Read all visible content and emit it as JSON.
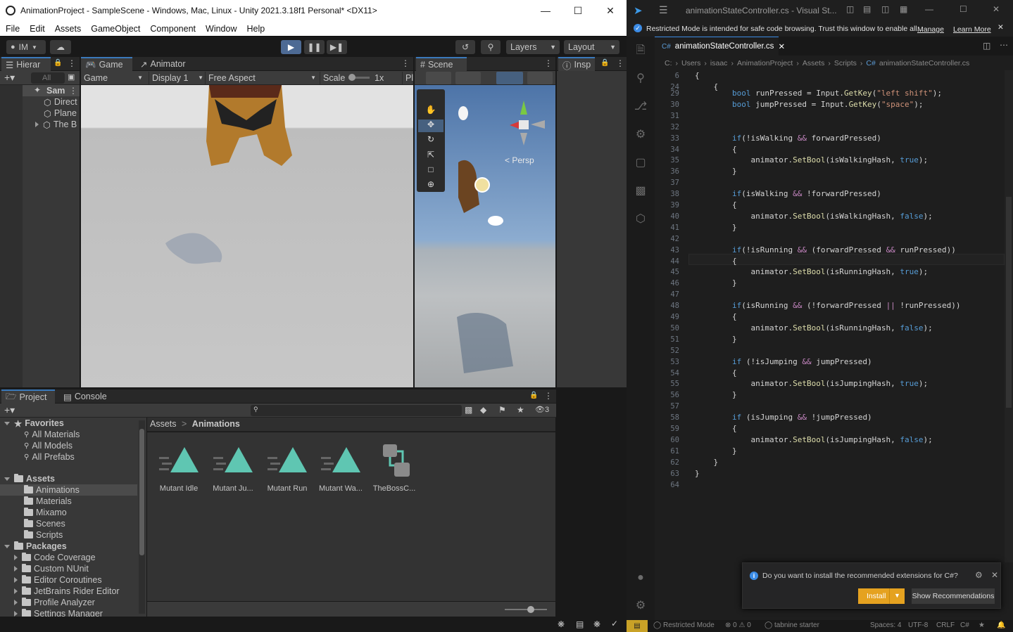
{
  "unity": {
    "title": "AnimationProject - SampleScene - Windows, Mac, Linux - Unity 2021.3.18f1 Personal* <DX11>",
    "menu": [
      "File",
      "Edit",
      "Assets",
      "GameObject",
      "Component",
      "Window",
      "Help"
    ],
    "account": "IM",
    "layers_label": "Layers",
    "layout_label": "Layout",
    "hierarchy": {
      "tab": "Hierar",
      "search_placeholder": "All",
      "scene": "Sam",
      "items": [
        "Direct",
        "Plane",
        "The B"
      ]
    },
    "game": {
      "tab_game": "Game",
      "tab_animator": "Animator",
      "dropdown_game": "Game",
      "display": "Display 1",
      "aspect": "Free Aspect",
      "scale_label": "Scale",
      "scale_value": "1x",
      "extra": "Pl"
    },
    "scene": {
      "tab": "Scene",
      "persp": "Persp"
    },
    "inspector": {
      "tab": "Insp"
    },
    "project": {
      "tab_project": "Project",
      "tab_console": "Console",
      "hidden_count": "3",
      "favorites_label": "Favorites",
      "favorites": [
        "All Materials",
        "All Models",
        "All Prefabs"
      ],
      "assets_label": "Assets",
      "asset_folders": [
        "Animations",
        "Materials",
        "Mixamo",
        "Scenes",
        "Scripts"
      ],
      "packages_label": "Packages",
      "packages": [
        "Code Coverage",
        "Custom NUnit",
        "Editor Coroutines",
        "JetBrains Rider Editor",
        "Profile Analyzer",
        "Settings Manager"
      ],
      "breadcrumb": [
        "Assets",
        "Animations"
      ],
      "assets": [
        "Mutant Idle",
        "Mutant Ju...",
        "Mutant Run",
        "Mutant Wa...",
        "TheBossC..."
      ]
    }
  },
  "vscode": {
    "title": "animationStateController.cs - Visual St...",
    "banner": "Restricted Mode is intended for safe code browsing. Trust this window to enable all...",
    "banner_manage": "Manage",
    "banner_learn": "Learn More",
    "tab_name": "animationStateController.cs",
    "breadcrumb": [
      "C:",
      "Users",
      "isaac",
      "AnimationProject",
      "Assets",
      "Scripts",
      "animationStateController.cs"
    ],
    "sticky": [
      {
        "n": "6",
        "t": "{"
      },
      {
        "n": "24",
        "t": "    {"
      }
    ],
    "lines": [
      {
        "n": "29",
        "t": "        bool runPressed = Input.GetKey(\"left shift\");"
      },
      {
        "n": "30",
        "t": "        bool jumpPressed = Input.GetKey(\"space\");"
      },
      {
        "n": "31",
        "t": ""
      },
      {
        "n": "32",
        "t": ""
      },
      {
        "n": "33",
        "t": "        if(!isWalking && forwardPressed)"
      },
      {
        "n": "34",
        "t": "        {"
      },
      {
        "n": "35",
        "t": "            animator.SetBool(isWalkingHash, true);"
      },
      {
        "n": "36",
        "t": "        }"
      },
      {
        "n": "37",
        "t": ""
      },
      {
        "n": "38",
        "t": "        if(isWalking && !forwardPressed)"
      },
      {
        "n": "39",
        "t": "        {"
      },
      {
        "n": "40",
        "t": "            animator.SetBool(isWalkingHash, false);"
      },
      {
        "n": "41",
        "t": "        }"
      },
      {
        "n": "42",
        "t": ""
      },
      {
        "n": "43",
        "t": "        if(!isRunning && (forwardPressed && runPressed))"
      },
      {
        "n": "44",
        "t": "        {"
      },
      {
        "n": "45",
        "t": "            animator.SetBool(isRunningHash, true);"
      },
      {
        "n": "46",
        "t": "        }"
      },
      {
        "n": "47",
        "t": ""
      },
      {
        "n": "48",
        "t": "        if(isRunning && (!forwardPressed || !runPressed))"
      },
      {
        "n": "49",
        "t": "        {"
      },
      {
        "n": "50",
        "t": "            animator.SetBool(isRunningHash, false);"
      },
      {
        "n": "51",
        "t": "        }"
      },
      {
        "n": "52",
        "t": ""
      },
      {
        "n": "53",
        "t": "        if (!isJumping && jumpPressed)"
      },
      {
        "n": "54",
        "t": "        {"
      },
      {
        "n": "55",
        "t": "            animator.SetBool(isJumpingHash, true);"
      },
      {
        "n": "56",
        "t": "        }"
      },
      {
        "n": "57",
        "t": ""
      },
      {
        "n": "58",
        "t": "        if (isJumping && !jumpPressed)"
      },
      {
        "n": "59",
        "t": "        {"
      },
      {
        "n": "60",
        "t": "            animator.SetBool(isJumpingHash, false);"
      },
      {
        "n": "61",
        "t": "        }"
      },
      {
        "n": "62",
        "t": "    }"
      },
      {
        "n": "63",
        "t": "}"
      },
      {
        "n": "64",
        "t": ""
      }
    ],
    "notification": {
      "text": "Do you want to install the recommended extensions for C#?",
      "install": "Install",
      "show": "Show Recommendations"
    },
    "status": {
      "restricted": "Restricted Mode",
      "errors": "0",
      "warnings": "0",
      "tabnine": "tabnine starter",
      "spaces": "Spaces: 4",
      "encoding": "UTF-8",
      "eol": "CRLF",
      "lang": "C#"
    }
  }
}
